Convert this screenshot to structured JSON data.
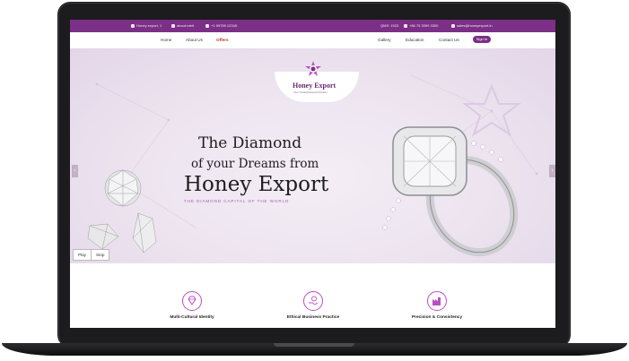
{
  "topbar": {
    "location": "Honey export, 1",
    "whatsapp": "about:rdelt",
    "phone_left": "+1 99789 12345",
    "qms": "QMS: 1923",
    "phone_right": "+86 75 3399 3300",
    "email": "sales@honeyexport.in"
  },
  "nav": {
    "home": "Home",
    "about": "About Us",
    "offers": "Offers",
    "gallery": "Gallery",
    "education": "Education",
    "contact": "Contact Us",
    "signin": "Sign In"
  },
  "logo": {
    "text": "Honey Export",
    "tagline": "Your Trusted Diamond Partner"
  },
  "hero": {
    "line1": "The Diamond",
    "line2": "of your Dreams from",
    "line3": "Honey Export",
    "tagline": "THE DIAMOND CAPITAL OF THE WORLD",
    "prev_arrow": "‹",
    "next_arrow": "›",
    "play": "Play",
    "stop": "Stop"
  },
  "features": [
    {
      "label": "Multi-Cultural Identity",
      "icon": "diamond-hand-icon"
    },
    {
      "label": "Ethical Business Practice",
      "icon": "ethical-hand-icon"
    },
    {
      "label": "Precision & Consistency",
      "icon": "factory-icon"
    }
  ],
  "colors": {
    "brand": "#7b2f86",
    "accent": "#b94fc4",
    "offers": "#c0392b"
  }
}
